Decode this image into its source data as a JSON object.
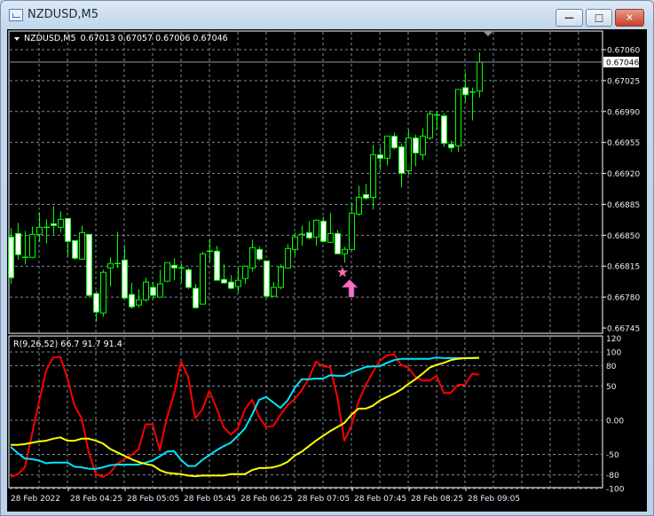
{
  "window": {
    "title": "NZDUSD,M5",
    "buttons": [
      "minimize",
      "maximize",
      "close"
    ]
  },
  "header": {
    "symbol": "NZDUSD,M5",
    "ohlc": "0.67013 0.67057 0.67006 0.67046"
  },
  "indicator": {
    "label": "R(9,26,52) 66.7 91.7 91.4"
  },
  "current_price": "0.67046",
  "colors": {
    "background": "#000000",
    "candle": "#00ff00",
    "bear_fill": "#ffffff",
    "grid": "#7d8a99",
    "fast_line": "#ff0000",
    "mid_line": "#00e5ff",
    "slow_line": "#ffff00",
    "arrow": "#ff6fb0"
  },
  "icons": {
    "arrow": "up-arrow-icon",
    "star": "star-icon"
  },
  "chart_data": [
    {
      "type": "candlestick",
      "symbol": "NZDUSD",
      "timeframe": "M5",
      "ylim": [
        0.66745,
        0.6706
      ],
      "y_ticks": [
        "0.67060",
        "0.67025",
        "0.66990",
        "0.66955",
        "0.66920",
        "0.66885",
        "0.66850",
        "0.66815",
        "0.66780",
        "0.66745"
      ],
      "x_ticks": [
        "28 Feb 2022",
        "28 Feb 04:25",
        "28 Feb 05:05",
        "28 Feb 05:45",
        "28 Feb 06:25",
        "28 Feb 07:05",
        "28 Feb 07:45",
        "28 Feb 08:25",
        "28 Feb 09:05"
      ],
      "grid": true,
      "ohlc": [
        [
          0.66848,
          0.66858,
          0.66795,
          0.66802
        ],
        [
          0.66852,
          0.66864,
          0.66822,
          0.66828
        ],
        [
          0.66825,
          0.66855,
          0.66817,
          0.66825
        ],
        [
          0.66825,
          0.6686,
          0.66824,
          0.66851
        ],
        [
          0.66851,
          0.66876,
          0.66842,
          0.66859
        ],
        [
          0.66859,
          0.66868,
          0.66841,
          0.66859
        ],
        [
          0.66863,
          0.66883,
          0.66851,
          0.66861
        ],
        [
          0.66859,
          0.66877,
          0.66853,
          0.66868
        ],
        [
          0.66869,
          0.66869,
          0.66826,
          0.66843
        ],
        [
          0.66844,
          0.66844,
          0.66822,
          0.66824
        ],
        [
          0.66823,
          0.66861,
          0.66822,
          0.66853
        ],
        [
          0.66851,
          0.66851,
          0.6678,
          0.66782
        ],
        [
          0.66784,
          0.66787,
          0.66752,
          0.66763
        ],
        [
          0.66762,
          0.66811,
          0.66758,
          0.66808
        ],
        [
          0.66813,
          0.66825,
          0.66792,
          0.66818
        ],
        [
          0.66818,
          0.66854,
          0.66813,
          0.66818
        ],
        [
          0.66822,
          0.66837,
          0.66778,
          0.66779
        ],
        [
          0.66783,
          0.66796,
          0.66767,
          0.66769
        ],
        [
          0.66771,
          0.66789,
          0.66768,
          0.66777
        ],
        [
          0.66777,
          0.66802,
          0.66775,
          0.66797
        ],
        [
          0.66791,
          0.66797,
          0.66778,
          0.66782
        ],
        [
          0.6678,
          0.66811,
          0.6678,
          0.66795
        ],
        [
          0.66798,
          0.66819,
          0.66797,
          0.66819
        ],
        [
          0.66816,
          0.66824,
          0.66799,
          0.66813
        ],
        [
          0.66813,
          0.66818,
          0.66797,
          0.66813
        ],
        [
          0.66811,
          0.66813,
          0.66789,
          0.66791
        ],
        [
          0.6679,
          0.66795,
          0.66767,
          0.66768
        ],
        [
          0.66772,
          0.66831,
          0.66772,
          0.66829
        ],
        [
          0.66832,
          0.66846,
          0.6682,
          0.66832
        ],
        [
          0.66832,
          0.66838,
          0.66799,
          0.66799
        ],
        [
          0.668,
          0.66817,
          0.66796,
          0.66796
        ],
        [
          0.66797,
          0.66805,
          0.66789,
          0.6679
        ],
        [
          0.66792,
          0.66813,
          0.66785,
          0.66799
        ],
        [
          0.66801,
          0.66815,
          0.66795,
          0.66815
        ],
        [
          0.66813,
          0.66845,
          0.66809,
          0.66836
        ],
        [
          0.66834,
          0.66837,
          0.66821,
          0.66823
        ],
        [
          0.66821,
          0.66821,
          0.6678,
          0.66781
        ],
        [
          0.66781,
          0.66797,
          0.66781,
          0.66791
        ],
        [
          0.66791,
          0.66817,
          0.66789,
          0.66814
        ],
        [
          0.66813,
          0.6684,
          0.66813,
          0.66835
        ],
        [
          0.66834,
          0.66853,
          0.66827,
          0.66848
        ],
        [
          0.66851,
          0.66861,
          0.66838,
          0.66851
        ],
        [
          0.66853,
          0.66866,
          0.66845,
          0.66847
        ],
        [
          0.66848,
          0.66868,
          0.66838,
          0.66867
        ],
        [
          0.66866,
          0.66871,
          0.66842,
          0.66843
        ],
        [
          0.66842,
          0.66875,
          0.66842,
          0.66852
        ],
        [
          0.66852,
          0.66856,
          0.66829,
          0.66829
        ],
        [
          0.66829,
          0.66837,
          0.66819,
          0.66834
        ],
        [
          0.66834,
          0.66886,
          0.66833,
          0.66875
        ],
        [
          0.66874,
          0.66906,
          0.66872,
          0.66893
        ],
        [
          0.66896,
          0.66908,
          0.6689,
          0.66892
        ],
        [
          0.66893,
          0.66952,
          0.66879,
          0.66941
        ],
        [
          0.66941,
          0.6695,
          0.66924,
          0.66937
        ],
        [
          0.66937,
          0.66962,
          0.66929,
          0.66962
        ],
        [
          0.66962,
          0.66966,
          0.66947,
          0.66949
        ],
        [
          0.6695,
          0.66954,
          0.66904,
          0.6692
        ],
        [
          0.66923,
          0.6697,
          0.66918,
          0.6696
        ],
        [
          0.6696,
          0.66964,
          0.66928,
          0.66943
        ],
        [
          0.66941,
          0.66971,
          0.66935,
          0.66962
        ],
        [
          0.6696,
          0.66991,
          0.66958,
          0.66987
        ],
        [
          0.66986,
          0.6699,
          0.66969,
          0.66986
        ],
        [
          0.66985,
          0.66988,
          0.6695,
          0.66954
        ],
        [
          0.66953,
          0.66957,
          0.66944,
          0.66949
        ],
        [
          0.66951,
          0.67015,
          0.66944,
          0.67015
        ],
        [
          0.67017,
          0.67034,
          0.67001,
          0.67009
        ],
        [
          0.67012,
          0.67017,
          0.6698,
          0.67012
        ],
        [
          0.67013,
          0.67057,
          0.67006,
          0.67046
        ]
      ],
      "signals": [
        {
          "type": "arrow-up",
          "bar_index": 48,
          "price": 0.668
        },
        {
          "type": "star",
          "bar_index": 47,
          "price": 0.66808
        }
      ]
    },
    {
      "type": "line",
      "ylim": [
        -100,
        120
      ],
      "y_ticks": [
        "120",
        "100",
        "80",
        "50",
        "0.00",
        "-50",
        "-80",
        "-100"
      ],
      "grid": true,
      "series": [
        {
          "color": "#ff0000",
          "values": [
            -83,
            -79,
            -69,
            -21,
            27,
            73,
            92,
            93,
            61,
            21,
            3,
            -47,
            -79,
            -83,
            -77,
            -64,
            -57,
            -51,
            -43,
            -6,
            -6,
            -44,
            3,
            38,
            86,
            64,
            3,
            16,
            43,
            18,
            -10,
            -21,
            -12,
            16,
            30,
            5,
            -10,
            -8,
            8,
            22,
            31,
            44,
            61,
            86,
            79,
            78,
            35,
            -30,
            -8,
            27,
            51,
            70,
            87,
            95,
            97,
            81,
            77,
            64,
            58,
            58,
            65,
            40,
            40,
            52,
            52,
            68,
            66.7
          ]
        },
        {
          "color": "#00e5ff",
          "values": [
            -39,
            -48,
            -56,
            -57,
            -59,
            -63,
            -62,
            -62,
            -62,
            -68,
            -69,
            -71,
            -71,
            -69,
            -66,
            -65,
            -65,
            -65,
            -65,
            -62,
            -59,
            -53,
            -46,
            -45,
            -58,
            -67,
            -67,
            -58,
            -51,
            -44,
            -38,
            -33,
            -23,
            -12,
            8,
            30,
            34,
            26,
            18,
            29,
            47,
            60,
            60,
            61,
            61,
            66,
            65,
            65,
            70,
            74,
            78,
            79,
            79,
            84,
            88,
            90,
            90,
            90,
            90,
            90,
            92,
            91,
            91,
            91,
            91,
            91,
            91.7
          ]
        },
        {
          "color": "#ffff00",
          "values": [
            -36,
            -36,
            -35,
            -33,
            -31,
            -30,
            -27,
            -25,
            -30,
            -30,
            -27,
            -27,
            -30,
            -34,
            -42,
            -47,
            -52,
            -57,
            -61,
            -64,
            -66,
            -73,
            -77,
            -78,
            -79,
            -81,
            -82,
            -81,
            -81,
            -81,
            -81,
            -79,
            -79,
            -79,
            -73,
            -70,
            -70,
            -69,
            -66,
            -61,
            -52,
            -46,
            -38,
            -30,
            -23,
            -16,
            -10,
            -4,
            8,
            17,
            17,
            21,
            29,
            34,
            39,
            45,
            53,
            60,
            68,
            77,
            81,
            84,
            88,
            90,
            91,
            91,
            91.4
          ]
        }
      ]
    }
  ]
}
